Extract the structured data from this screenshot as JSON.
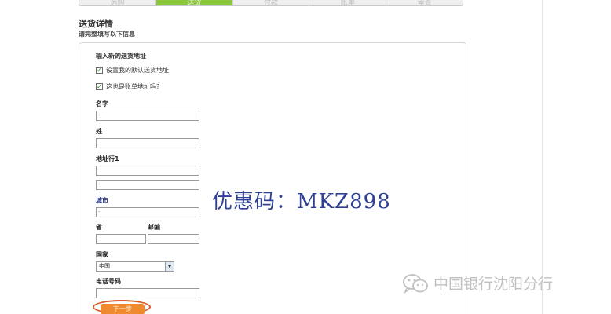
{
  "tabs": [
    "选购",
    "送货",
    "付款",
    "账单",
    "审查"
  ],
  "active_tab_index": 1,
  "section": {
    "title": "送货详情",
    "subtitle": "请完整填写以下信息"
  },
  "form": {
    "title": "输入新的送货地址",
    "checkbox_default": {
      "label": "设置我的默认送货地址",
      "checked": true
    },
    "checkbox_billing": {
      "label": "这也是账单地址吗?",
      "checked": true
    },
    "first_name": {
      "label": "名字",
      "value": "·"
    },
    "last_name": {
      "label": "姓",
      "value": ""
    },
    "address1": {
      "label": "地址行1",
      "value": ""
    },
    "address2": {
      "value": "·"
    },
    "city": {
      "label": "城市",
      "value": "·"
    },
    "province": {
      "label": "省",
      "value": ""
    },
    "postcode": {
      "label": "邮编",
      "value": ""
    },
    "country": {
      "label": "国家",
      "value": "中国"
    },
    "phone": {
      "label": "电话号码",
      "value": ""
    },
    "next_label": "下一步"
  },
  "promo": {
    "text": "优惠码：MKZ898"
  },
  "watermark": {
    "text": "中国银行沈阳分行",
    "icon": "wechat-icon"
  },
  "colors": {
    "active_tab": "#8cc63f",
    "next_button": "#f08a2e",
    "promo_text": "#2f3f94"
  }
}
